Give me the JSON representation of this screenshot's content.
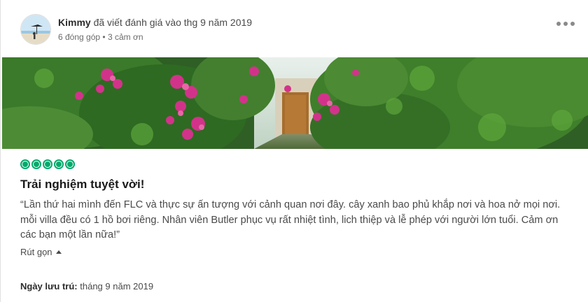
{
  "reviewer": {
    "name": "Kimmy",
    "action": " đã viết đánh giá vào thg 9 năm 2019",
    "contributions": "6 đóng góp",
    "separator": " • ",
    "helpful": "3 cảm ơn"
  },
  "review": {
    "rating": 5,
    "rating_max": 5,
    "title": "Trải nghiệm tuyệt vời!",
    "text": "“Lần thứ hai mình đến FLC và thực sự ấn tượng với cảnh quan nơi đây. cây xanh bao phủ khắp nơi và hoa nở mọi nơi. mỗi villa đều có 1 hồ bơi riêng. Nhân viên Butler phục vụ rất nhiệt tình, lich thiệp và lễ phép với người lớn tuổi. Cảm ơn các bạn một lần nữa!”",
    "collapse_label": "Rút gọn",
    "stay_label": "Ngày lưu trú:",
    "stay_value": " tháng 9 năm 2019"
  },
  "colors": {
    "bubble": "#00aa6c",
    "text": "#4a4a4a"
  },
  "icons": {
    "more": "more-dots-icon",
    "collapse": "caret-up-icon"
  }
}
